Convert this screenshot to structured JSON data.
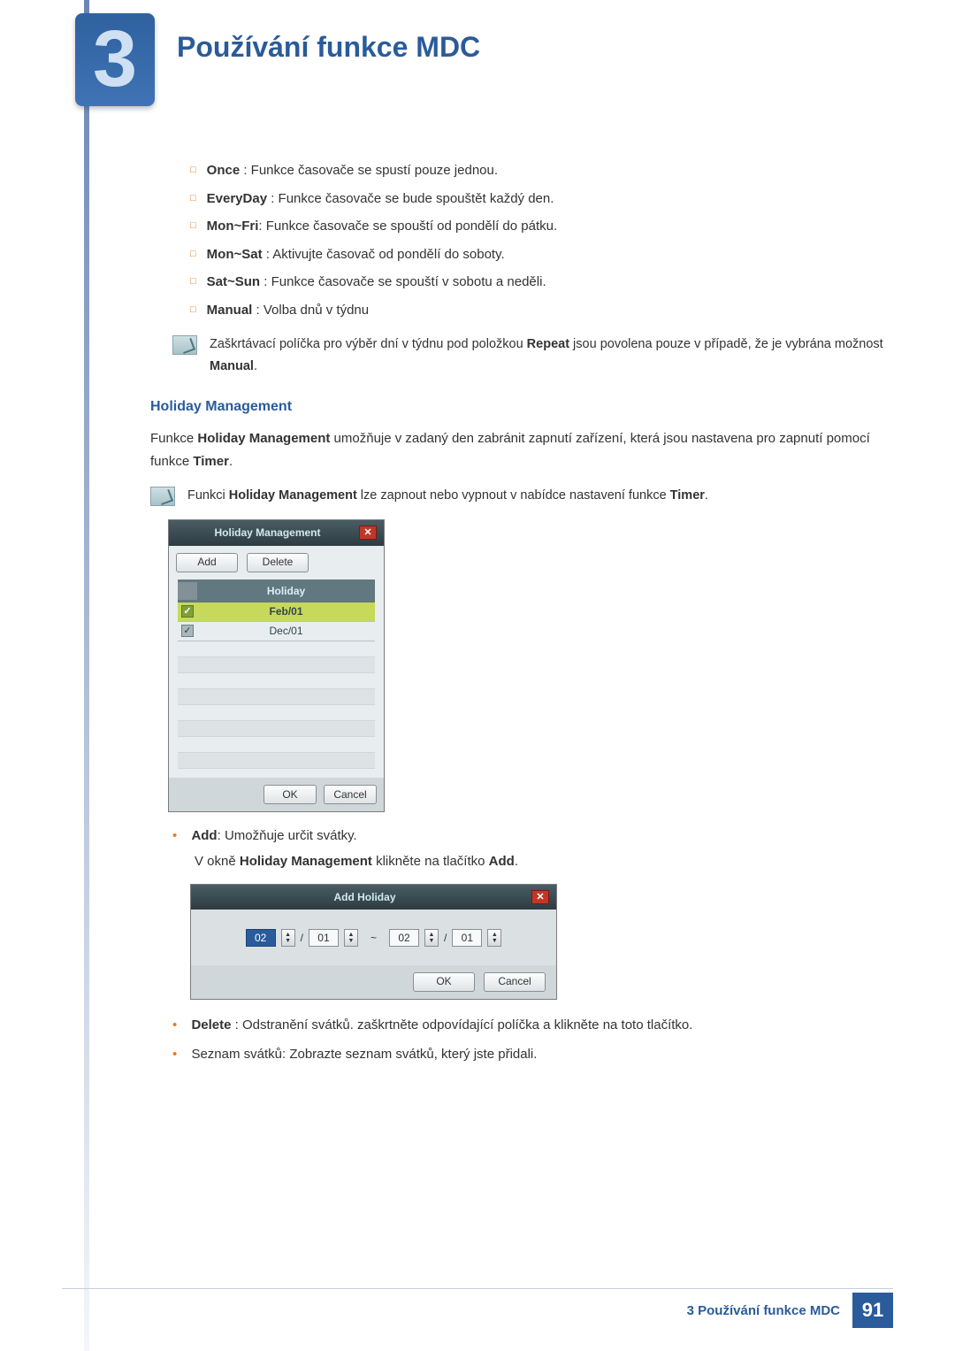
{
  "chapter": {
    "number": "3",
    "title": "Používání funkce MDC"
  },
  "timer_options": [
    {
      "name": "Once",
      "desc": " : Funkce časovače se spustí pouze jednou."
    },
    {
      "name": "EveryDay",
      "desc": " : Funkce časovače se bude spouštět každý den."
    },
    {
      "name": "Mon~Fri",
      "desc": ": Funkce časovače se spouští od pondělí do pátku."
    },
    {
      "name": "Mon~Sat",
      "desc": " : Aktivujte časovač od pondělí do soboty."
    },
    {
      "name": "Sat~Sun",
      "desc": " : Funkce časovače se spouští v sobotu a neděli."
    },
    {
      "name": "Manual",
      "desc": " : Volba dnů v týdnu"
    }
  ],
  "note1": {
    "pre": "Zaškrtávací políčka pro výběr dní v týdnu pod položkou ",
    "b1": "Repeat",
    "mid": " jsou povolena pouze v případě, že je vybrána možnost ",
    "b2": "Manual",
    "post": "."
  },
  "hm_section": {
    "heading": "Holiday Management",
    "p_pre": "Funkce ",
    "p_b1": "Holiday Management",
    "p_mid": " umožňuje v zadaný den zabránit zapnutí zařízení, která jsou nastavena pro zapnutí pomocí funkce ",
    "p_b2": "Timer",
    "p_post": "."
  },
  "note2": {
    "pre": "Funkci ",
    "b1": "Holiday Management",
    "mid": " lze zapnout nebo vypnout v nabídce nastavení funkce ",
    "b2": "Timer",
    "post": "."
  },
  "hm_dialog": {
    "title": "Holiday Management",
    "add": "Add",
    "delete": "Delete",
    "col": "Holiday",
    "rows": [
      "Feb/01",
      "Dec/01"
    ],
    "ok": "OK",
    "cancel": "Cancel"
  },
  "bullets": {
    "add_b": "Add",
    "add_t": ": Umožňuje určit svátky.",
    "add_sub_pre": "V okně ",
    "add_sub_b1": "Holiday Management",
    "add_sub_mid": " klikněte na tlačítko ",
    "add_sub_b2": "Add",
    "add_sub_post": ".",
    "del_b": "Delete",
    "del_t": " : Odstranění svátků. zaškrtněte odpovídající políčka a klikněte na toto tlačítko.",
    "list_t": "Seznam svátků: Zobrazte seznam svátků, který jste přidali."
  },
  "ah_dialog": {
    "title": "Add Holiday",
    "from_m": "02",
    "from_d": "01",
    "sep": "~",
    "to_m": "02",
    "to_d": "01",
    "slash": "/",
    "ok": "OK",
    "cancel": "Cancel"
  },
  "footer": {
    "label": "3 Používání funkce MDC",
    "page": "91"
  }
}
